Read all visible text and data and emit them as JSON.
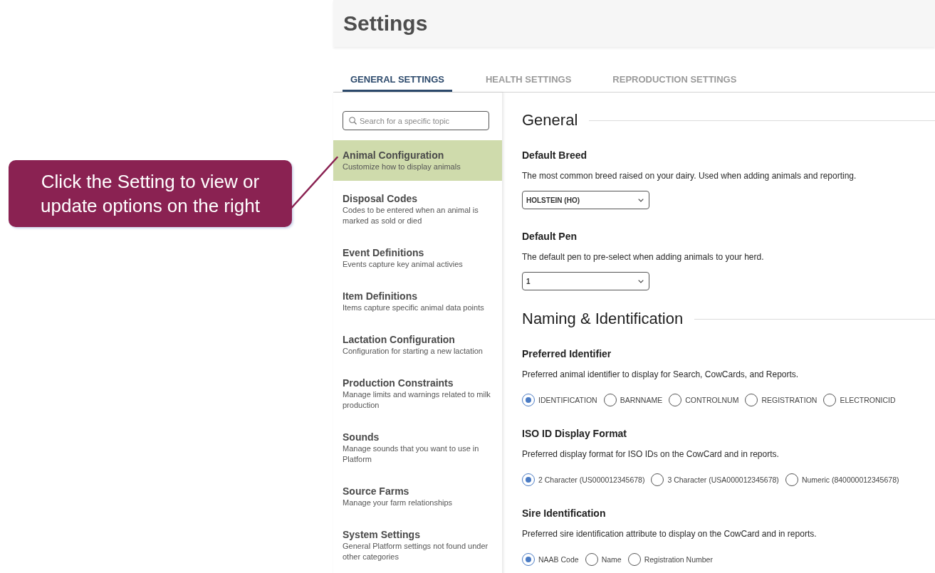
{
  "annotation": {
    "text": "Click the Setting to view or update options on the right"
  },
  "header": {
    "title": "Settings"
  },
  "tabs": [
    {
      "label": "GENERAL SETTINGS",
      "selected": true
    },
    {
      "label": "HEALTH SETTINGS",
      "selected": false
    },
    {
      "label": "REPRODUCTION SETTINGS",
      "selected": false
    }
  ],
  "sidebar": {
    "search": {
      "placeholder": "Search for a specific topic"
    },
    "items": [
      {
        "title": "Animal Configuration",
        "description": "Customize how to display animals",
        "selected": true
      },
      {
        "title": "Disposal Codes",
        "description": "Codes to be entered when an animal is marked as sold or died",
        "selected": false
      },
      {
        "title": "Event Definitions",
        "description": "Events capture key animal activies",
        "selected": false
      },
      {
        "title": "Item Definitions",
        "description": "Items capture specific animal data points",
        "selected": false
      },
      {
        "title": "Lactation Configuration",
        "description": "Configuration for starting a new lactation",
        "selected": false
      },
      {
        "title": "Production Constraints",
        "description": "Manage limits and warnings related to milk production",
        "selected": false
      },
      {
        "title": "Sounds",
        "description": "Manage sounds that you want to use in Platform",
        "selected": false
      },
      {
        "title": "Source Farms",
        "description": "Manage your farm relationships",
        "selected": false
      },
      {
        "title": "System Settings",
        "description": "General Platform settings not found under other categories",
        "selected": false
      }
    ]
  },
  "sections": [
    {
      "heading": "General",
      "settings": [
        {
          "kind": "select",
          "title": "Default Breed",
          "description": "The most common breed raised on your dairy. Used when adding animals and reporting.",
          "value": "HOLSTEIN (HO)"
        },
        {
          "kind": "select",
          "title": "Default Pen",
          "description": "The default pen to pre-select when adding animals to your herd.",
          "value": "1"
        }
      ]
    },
    {
      "heading": "Naming & Identification",
      "settings": [
        {
          "kind": "radio",
          "title": "Preferred Identifier",
          "description": "Preferred animal identifier to display for Search, CowCards, and Reports.",
          "options": [
            {
              "label": "IDENTIFICATION",
              "selected": true
            },
            {
              "label": "BARNNAME",
              "selected": false
            },
            {
              "label": "CONTROLNUM",
              "selected": false
            },
            {
              "label": "REGISTRATION",
              "selected": false
            },
            {
              "label": "ELECTRONICID",
              "selected": false
            }
          ]
        },
        {
          "kind": "radio",
          "title": "ISO ID Display Format",
          "description": "Preferred display format for ISO IDs on the CowCard and in reports.",
          "options": [
            {
              "label": "2 Character (US000012345678)",
              "selected": true
            },
            {
              "label": "3 Character (USA000012345678)",
              "selected": false
            },
            {
              "label": "Numeric (840000012345678)",
              "selected": false
            }
          ]
        },
        {
          "kind": "radio",
          "title": "Sire Identification",
          "description": "Preferred sire identification attribute to display on the CowCard and in reports.",
          "options": [
            {
              "label": "NAAB Code",
              "selected": true
            },
            {
              "label": "Name",
              "selected": false
            },
            {
              "label": "Registration Number",
              "selected": false
            }
          ]
        }
      ]
    }
  ]
}
